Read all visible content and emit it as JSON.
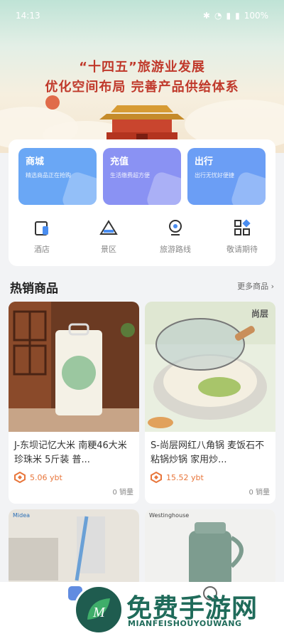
{
  "status_bar": {
    "time": "14:13",
    "battery": "100%"
  },
  "banner": {
    "line1": "“十四五”旅游业发展",
    "line2": "优化空间布局 完善产品供给体系"
  },
  "tiles": [
    {
      "title": "商城",
      "subtitle": "精选商品正在抢购",
      "color": "#6aa7f5"
    },
    {
      "title": "充值",
      "subtitle": "生活缴费超方便",
      "color": "#8a92f3"
    },
    {
      "title": "出行",
      "subtitle": "出行无忧好便捷",
      "color": "#6b9ef5"
    }
  ],
  "services": [
    {
      "label": "酒店",
      "icon": "hotel-icon"
    },
    {
      "label": "景区",
      "icon": "scenic-icon"
    },
    {
      "label": "旅游路线",
      "icon": "route-icon"
    },
    {
      "label": "敬请期待",
      "icon": "coming-soon-icon"
    }
  ],
  "section": {
    "title": "热销商品",
    "more": "更多商品"
  },
  "products": [
    {
      "name": "J-东坝记忆大米 南粳46大米珍珠米 5斤装 普...",
      "price": "5.06 ybt",
      "sold": "0 销量"
    },
    {
      "name": "S-尚层网红八角锅 麦饭石不粘锅炒锅 家用炒...",
      "price": "15.52 ybt",
      "sold": "0 销量",
      "brand": "尚层"
    }
  ],
  "lower_products": [
    {
      "brand": "Midea"
    },
    {
      "brand": "Westinghouse"
    }
  ],
  "watermark": {
    "title": "免费手游网",
    "subtitle": "MIANFEISHOUYOUWANG"
  }
}
